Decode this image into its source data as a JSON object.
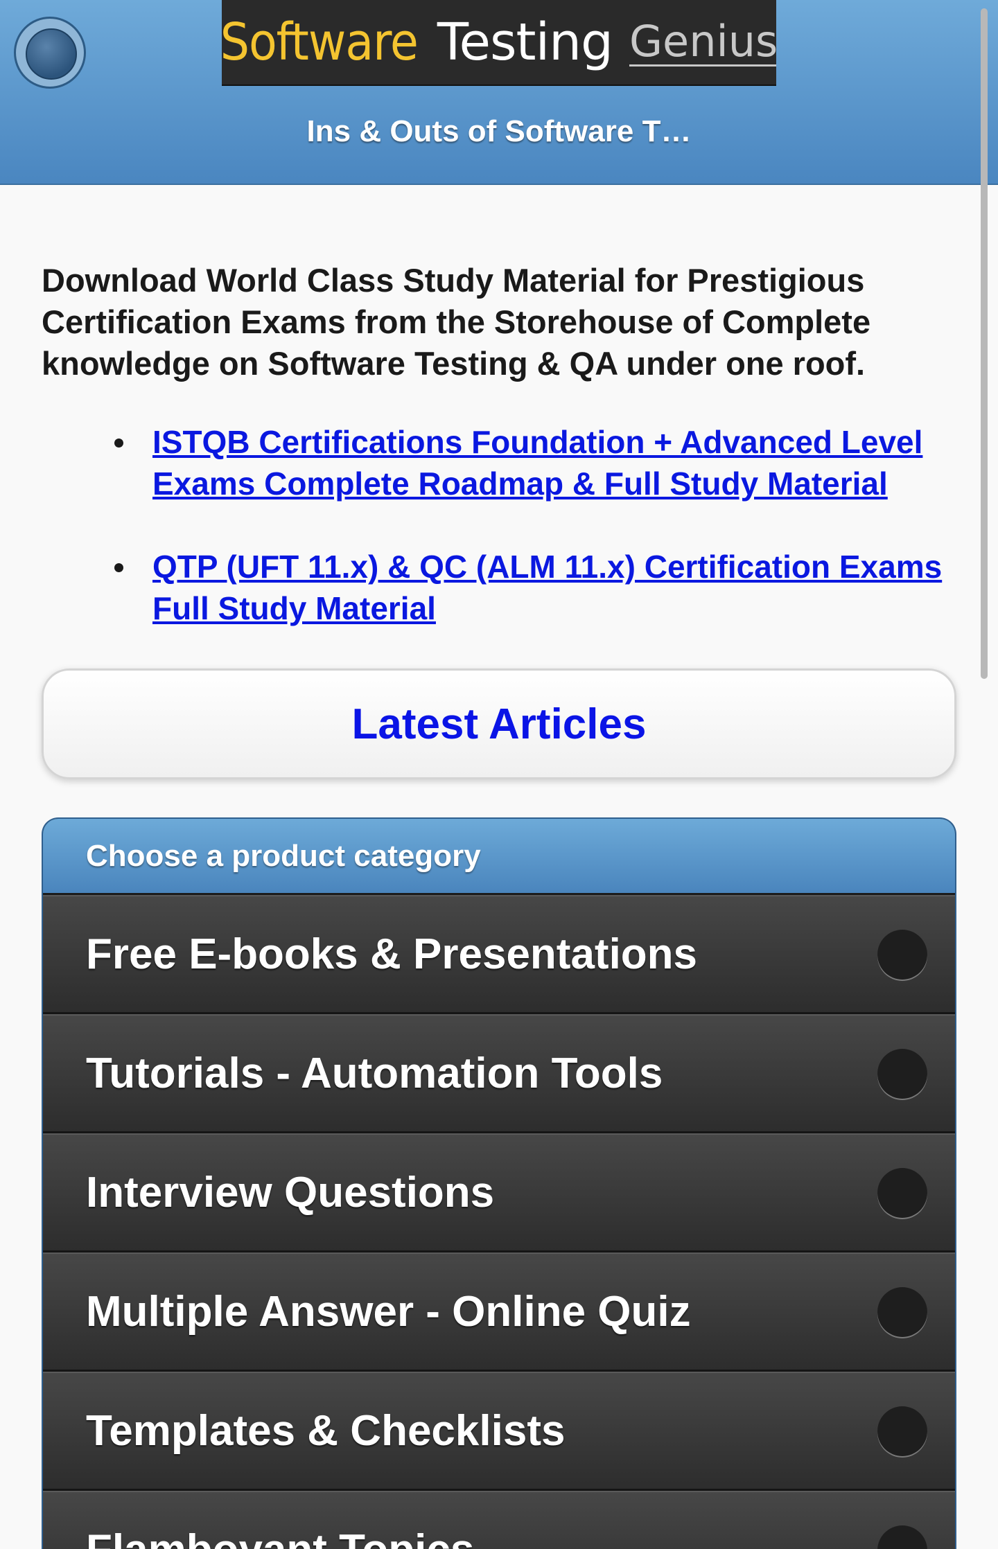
{
  "header": {
    "logo": {
      "word1": "Software",
      "word2": "Testing",
      "word3": "Genius"
    },
    "title": "Ins & Outs of Software T…",
    "menu_icon": "circle-menu-icon"
  },
  "intro": {
    "text": "Download World Class Study Material for Prestigious Certification Exams from the Storehouse of Complete knowledge on Software Testing & QA under one roof."
  },
  "links": [
    {
      "label": "ISTQB Certifications Foundation + Advanced Level Exams Complete Roadmap & Full Study Material"
    },
    {
      "label": "QTP (UFT 11.x) & QC (ALM 11.x) Certification Exams Full Study Material"
    }
  ],
  "latest_button": {
    "label": "Latest Articles"
  },
  "category": {
    "header": "Choose a product category",
    "items": [
      {
        "label": "Free E-books & Presentations"
      },
      {
        "label": "Tutorials - Automation Tools"
      },
      {
        "label": "Interview Questions"
      },
      {
        "label": "Multiple Answer - Online Quiz"
      },
      {
        "label": "Templates & Checklists"
      },
      {
        "label": "Flamboyant Topics"
      }
    ]
  },
  "colors": {
    "header_top": "#6faad9",
    "header_bottom": "#4a86c0",
    "link": "#0a18e0",
    "list_bg": "#2f2f2f",
    "logo_yellow": "#f4c430"
  }
}
